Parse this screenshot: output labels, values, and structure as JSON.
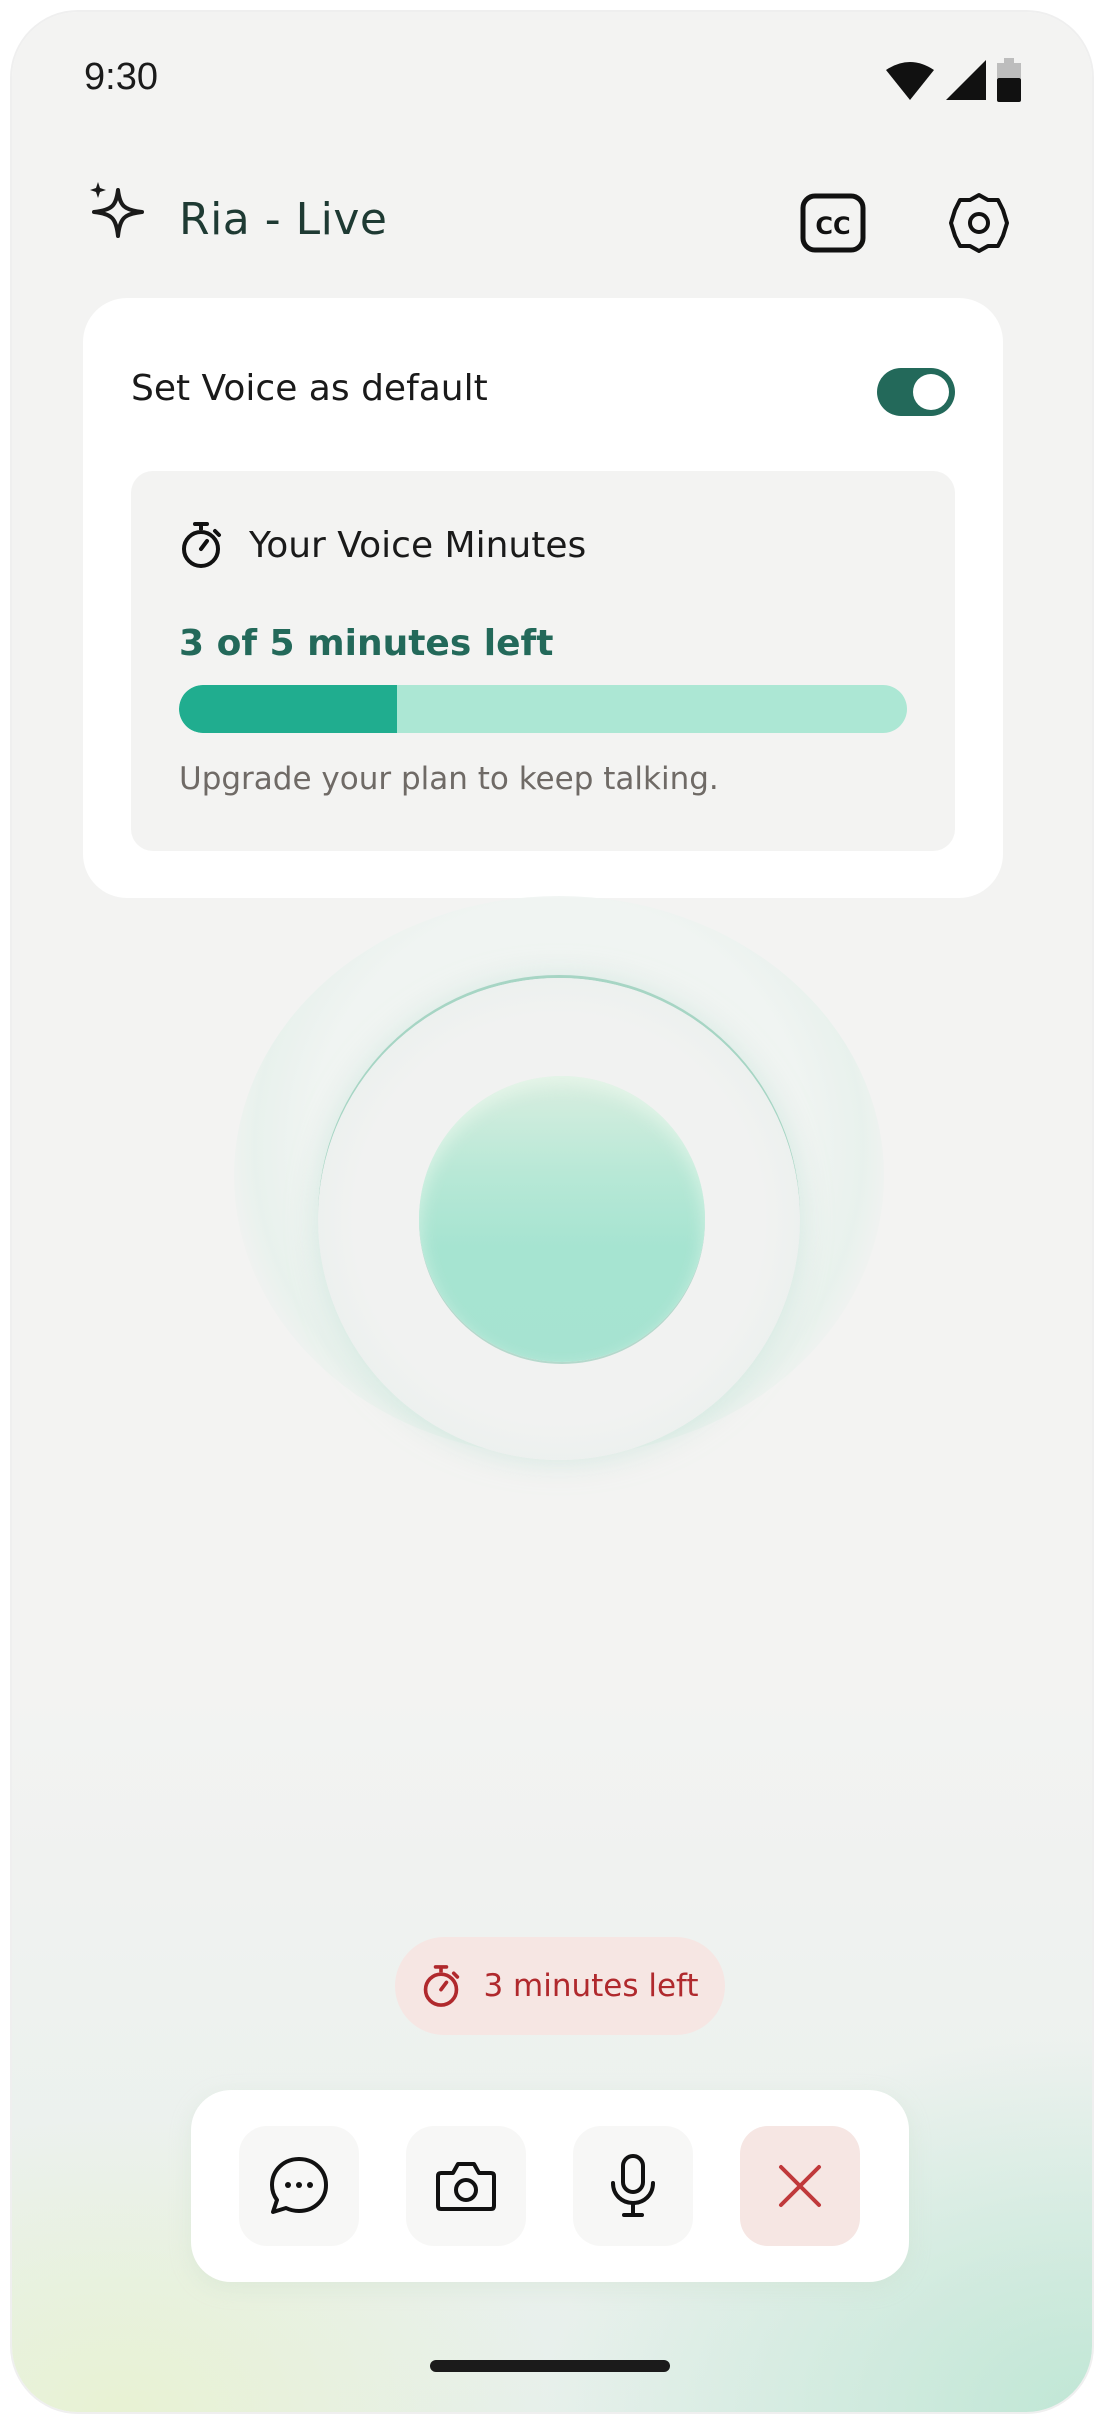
{
  "status_bar": {
    "time": "9:30",
    "icons": [
      "wifi-icon",
      "signal-icon",
      "battery-icon"
    ]
  },
  "header": {
    "title": "Ria - Live",
    "icons": [
      "sparkle-icon",
      "closed-captions-icon",
      "settings-icon"
    ]
  },
  "voice_card": {
    "default_label": "Set Voice as default",
    "default_enabled": true,
    "minutes_title": "Your Voice Minutes",
    "minutes_left_text": "3 of 5 minutes left",
    "minutes_progress": 0.3,
    "upgrade_text": "Upgrade your plan to keep talking."
  },
  "time_pill": {
    "label": "3 minutes left"
  },
  "actions": [
    {
      "name": "chat",
      "icon": "chat-icon"
    },
    {
      "name": "camera",
      "icon": "camera-icon"
    },
    {
      "name": "microphone",
      "icon": "microphone-icon"
    },
    {
      "name": "end-call",
      "icon": "close-icon"
    }
  ],
  "colors": {
    "accent": "#23695a",
    "progress_fill": "#20ad8f",
    "progress_track": "#ace7d4",
    "warning_text": "#b0292d",
    "warning_bg": "#f6e6e3"
  }
}
